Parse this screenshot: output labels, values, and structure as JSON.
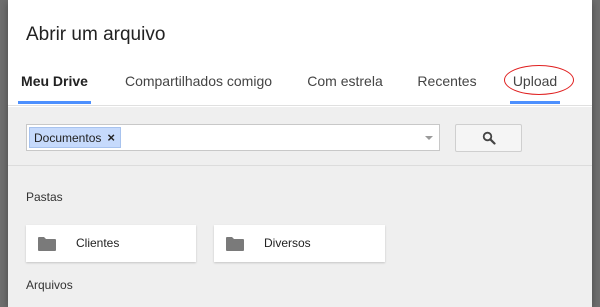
{
  "dialog": {
    "title": "Abrir um arquivo"
  },
  "tabs": [
    {
      "label": "Meu Drive",
      "active": true
    },
    {
      "label": "Compartilhados comigo",
      "active": false
    },
    {
      "label": "Com estrela",
      "active": false
    },
    {
      "label": "Recentes",
      "active": false
    },
    {
      "label": "Upload",
      "active": false,
      "annotated": true
    }
  ],
  "search": {
    "chip_label": "Documentos",
    "chip_remove": "×",
    "button_icon": "search-icon"
  },
  "sections": {
    "folders_label": "Pastas",
    "files_label": "Arquivos"
  },
  "folders": [
    {
      "name": "Clientes",
      "icon": "folder-icon"
    },
    {
      "name": "Diversos",
      "icon": "folder-icon"
    }
  ],
  "colors": {
    "accent": "#4d90fe",
    "chip_bg": "#c6dafc",
    "annotation": "#e02020",
    "content_bg": "#efefef"
  }
}
